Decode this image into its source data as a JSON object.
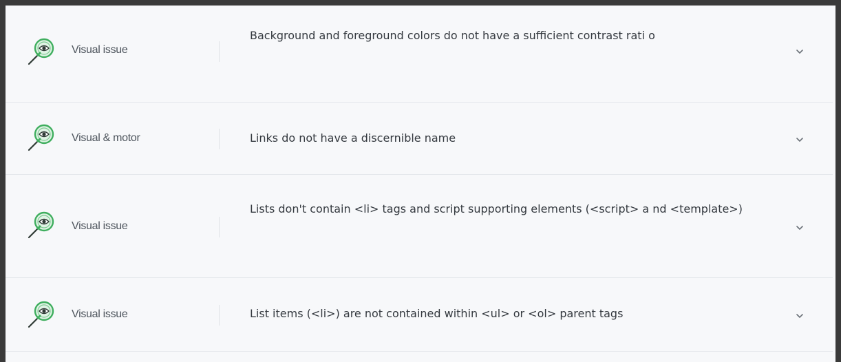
{
  "issues": [
    {
      "category": "Visual issue",
      "title": "Background and foreground colors do not have a sufficient contrast rati o",
      "icon": "magnifier-eye-icon",
      "expand_icon": "chevron-down-icon"
    },
    {
      "category": "Visual & motor",
      "title": "Links do not have a discernible name",
      "icon": "magnifier-eye-icon",
      "expand_icon": "chevron-down-icon"
    },
    {
      "category": "Visual issue",
      "title": "Lists don't contain <li> tags and script supporting elements (<script> a nd <template>)",
      "icon": "magnifier-eye-icon",
      "expand_icon": "chevron-down-icon"
    },
    {
      "category": "Visual issue",
      "title": "List items (<li>) are not contained within <ul> or <ol> parent tags",
      "icon": "magnifier-eye-icon",
      "expand_icon": "chevron-down-icon"
    }
  ],
  "colors": {
    "frame": "#3a3a3a",
    "background": "#f7f8fa",
    "icon_green": "#3fae5e",
    "text": "#34393f",
    "category_text": "#4d545c"
  }
}
